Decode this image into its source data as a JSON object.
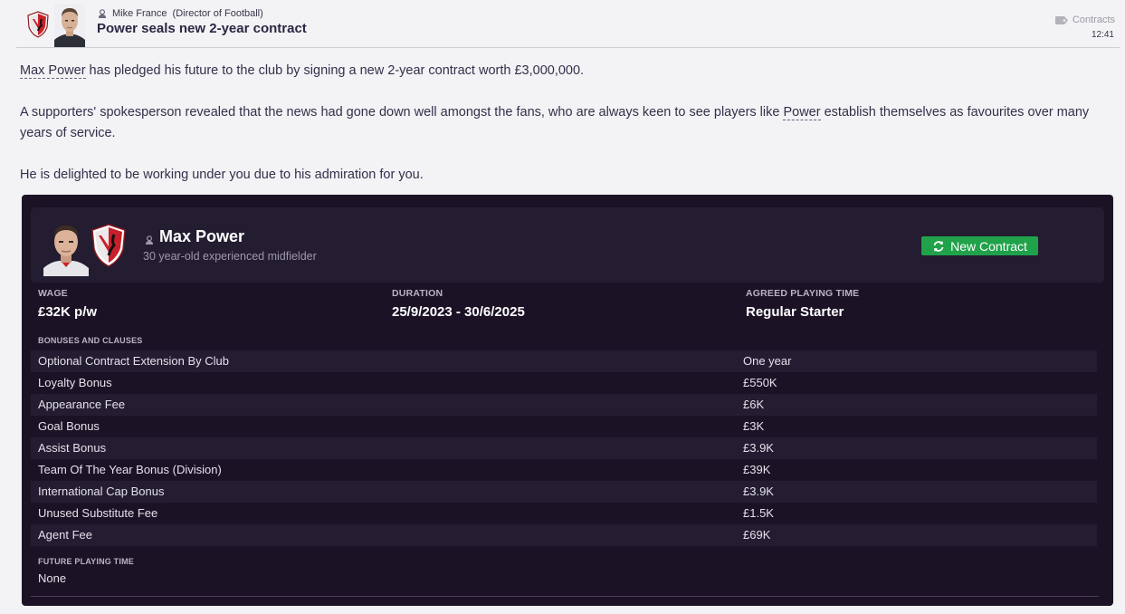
{
  "header": {
    "sender": "Mike France",
    "sender_role": "(Director of Football)",
    "headline": "Power seals new 2-year contract",
    "category": "Contracts",
    "time": "12:41"
  },
  "body": {
    "p1_link": "Max Power",
    "p1_text": " has pledged his future to the club by signing a new 2-year contract worth £3,000,000.",
    "p2_text_a": "A supporters' spokesperson revealed that the news had gone down well amongst the fans, who are always keen to see players like ",
    "p2_link": "Power",
    "p2_text_b": " establish themselves as favourites over many years of service.",
    "p3_text": "He is delighted to be working under you due to his admiration for you."
  },
  "player": {
    "name": "Max Power",
    "description": "30 year-old experienced midfielder",
    "new_contract_label": "New Contract"
  },
  "contract": {
    "wage_label": "WAGE",
    "wage_value": "£32K p/w",
    "duration_label": "DURATION",
    "duration_value": "25/9/2023 - 30/6/2025",
    "playing_time_label": "AGREED PLAYING TIME",
    "playing_time_value": "Regular Starter",
    "bonuses_label": "BONUSES AND CLAUSES",
    "bonuses": [
      {
        "name": "Optional Contract Extension By Club",
        "value": "One year"
      },
      {
        "name": "Loyalty Bonus",
        "value": "£550K"
      },
      {
        "name": "Appearance Fee",
        "value": "£6K"
      },
      {
        "name": "Goal Bonus",
        "value": "£3K"
      },
      {
        "name": "Assist Bonus",
        "value": "£3.9K"
      },
      {
        "name": "Team Of The Year Bonus (Division)",
        "value": "£39K"
      },
      {
        "name": "International Cap Bonus",
        "value": "£3.9K"
      },
      {
        "name": "Unused Substitute Fee",
        "value": "£1.5K"
      },
      {
        "name": "Agent Fee",
        "value": "£69K"
      }
    ],
    "future_label": "FUTURE PLAYING TIME",
    "future_value": "None"
  },
  "colors": {
    "panel_bg": "#1b1325",
    "card_bg": "#241c31",
    "accent_green": "#20a24a",
    "club_red": "#c8202a"
  }
}
